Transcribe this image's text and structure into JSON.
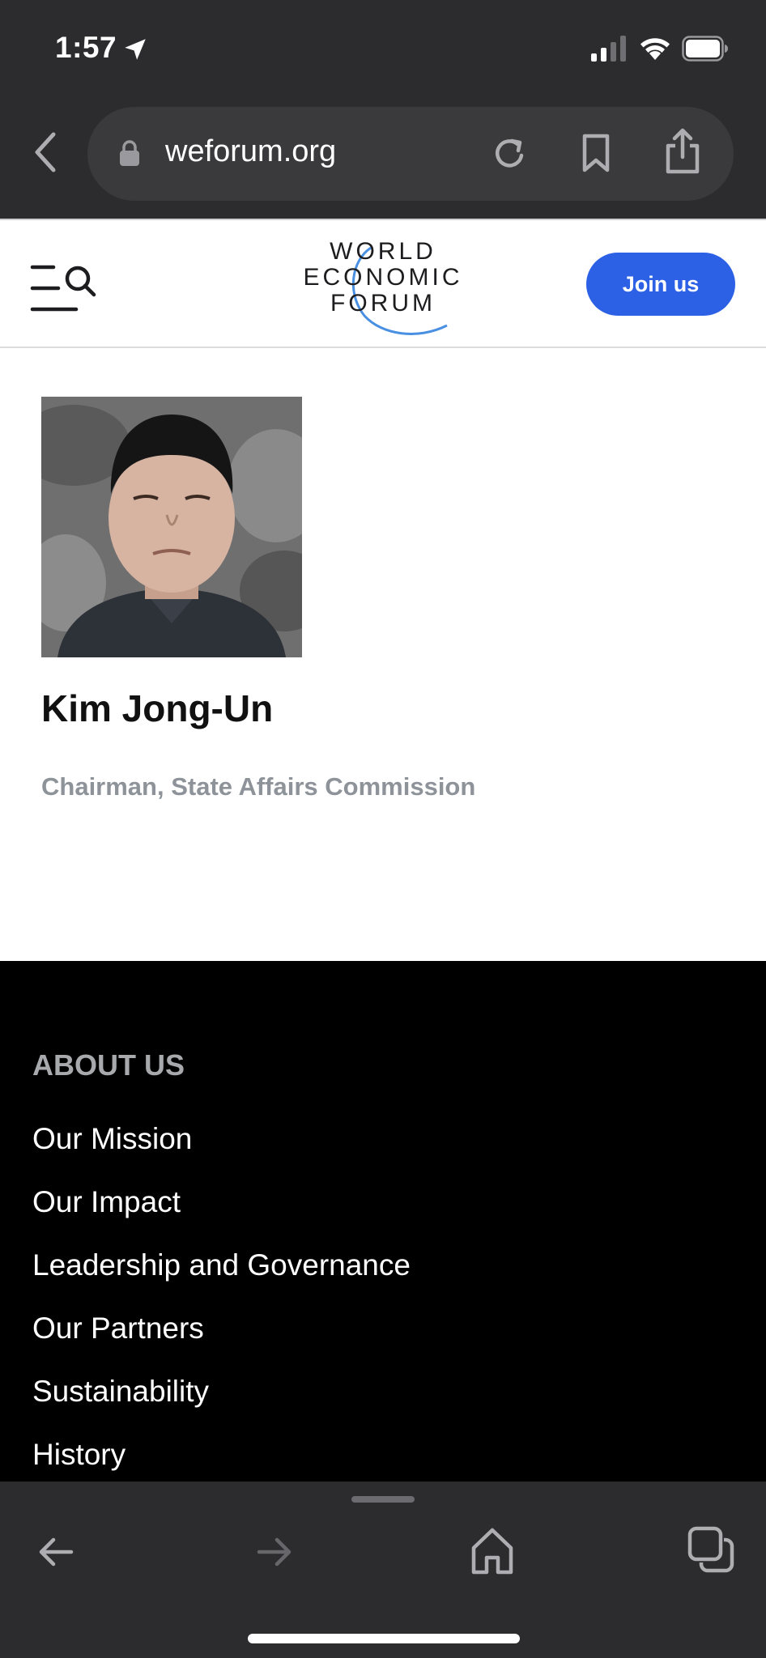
{
  "status_bar": {
    "time": "1:57",
    "icons": [
      "location-arrow-icon",
      "cellular-signal-icon",
      "wifi-icon",
      "battery-icon"
    ]
  },
  "browser": {
    "url": "weforum.org",
    "icons": [
      "back-chevron-icon",
      "lock-icon",
      "reload-icon",
      "bookmark-icon",
      "share-icon"
    ]
  },
  "header": {
    "logo_lines": [
      "WORLD",
      "ECONOMIC",
      "FORUM"
    ],
    "join_label": "Join us",
    "accent_color": "#2c61e6"
  },
  "profile": {
    "name": "Kim Jong-Un",
    "title": "Chairman, State Affairs Commission"
  },
  "footer": {
    "heading": "ABOUT US",
    "links": [
      "Our Mission",
      "Our Impact",
      "Leadership and Governance",
      "Our Partners",
      "Sustainability",
      "History"
    ]
  },
  "toolbar": {
    "icons": [
      "back-arrow-icon",
      "forward-arrow-icon",
      "home-icon",
      "tabs-icon"
    ]
  }
}
